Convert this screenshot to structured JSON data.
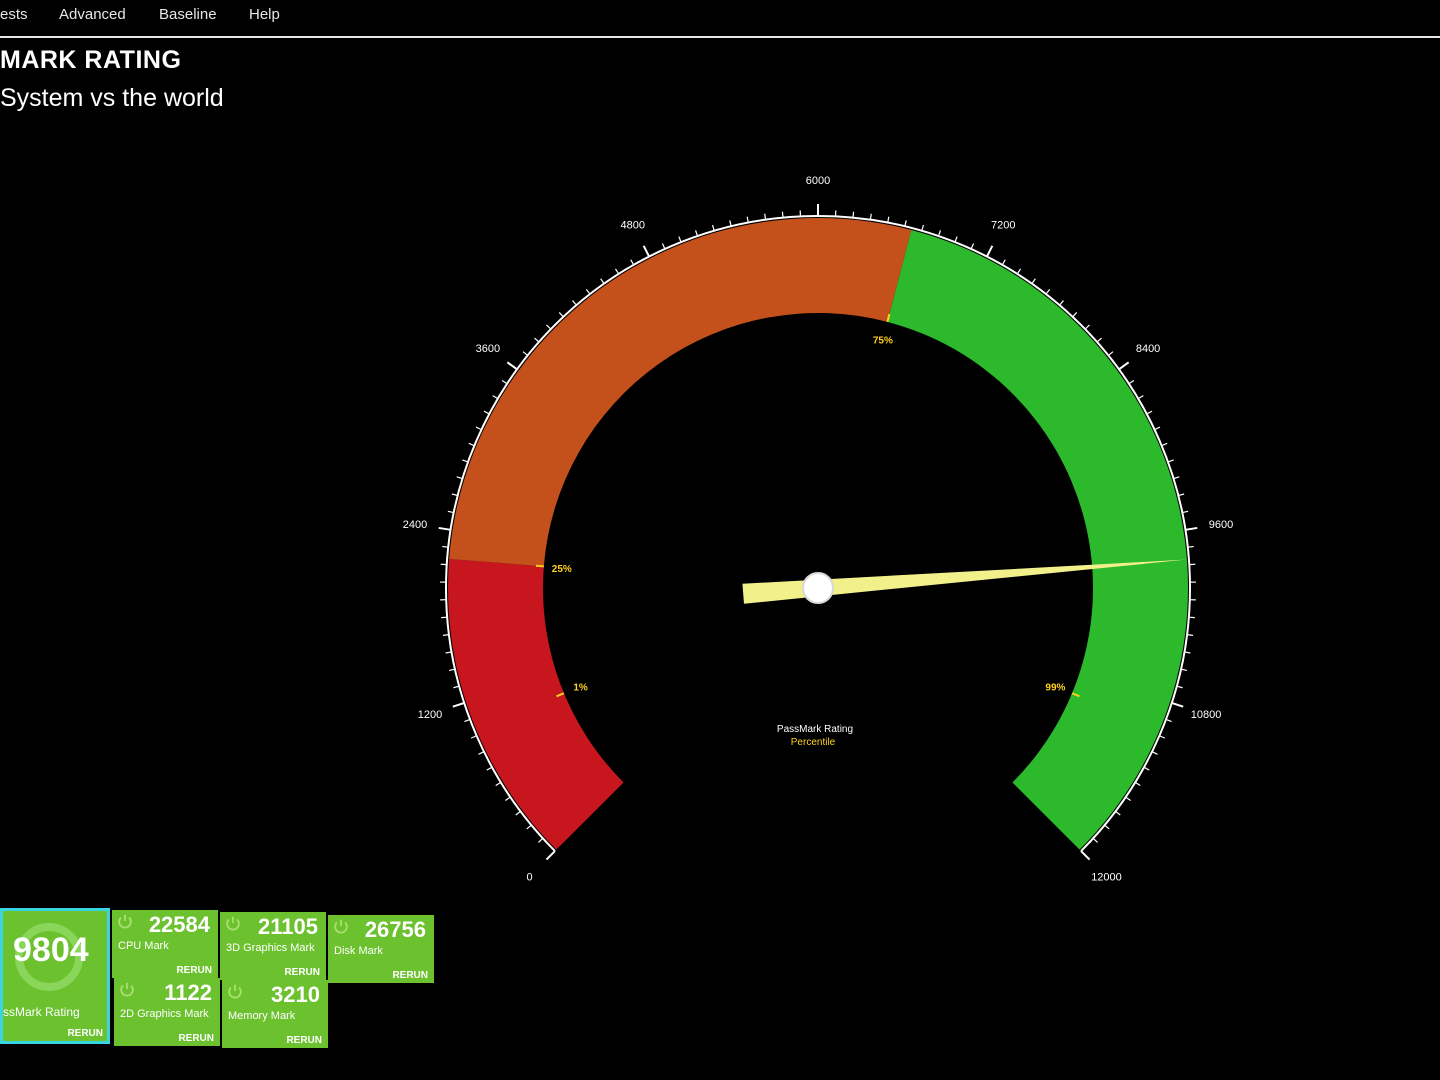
{
  "menu": {
    "items": [
      "ests",
      "Advanced",
      "Baseline",
      "Help"
    ]
  },
  "header": {
    "title": "MARK RATING",
    "subtitle": "System vs the world"
  },
  "gauge": {
    "min": 0,
    "max": 12000,
    "value": 9804,
    "tick_labels": [
      "0",
      "1200",
      "2400",
      "3600",
      "4800",
      "6000",
      "7200",
      "8400",
      "9600",
      "10800",
      "12000"
    ],
    "percentile_markers": [
      {
        "label": "1%",
        "value": 1000
      },
      {
        "label": "25%",
        "value": 2200
      },
      {
        "label": "75%",
        "value": 6650
      },
      {
        "label": "99%",
        "value": 11000
      }
    ],
    "bands": [
      {
        "from": 0,
        "to": 2200,
        "color": "#c8161e"
      },
      {
        "from": 2200,
        "to": 6650,
        "color": "#c4501c"
      },
      {
        "from": 6650,
        "to": 12000,
        "color": "#2cb92c"
      }
    ],
    "center_label": "PassMark Rating",
    "center_sublabel": "Percentile",
    "needle_color": "#f2f08a",
    "accent_color": "#ffd21e"
  },
  "tiles": {
    "main": {
      "value": "9804",
      "label": "ssMark Rating",
      "rerun": "RERUN"
    },
    "items": [
      {
        "value": "22584",
        "label": "CPU Mark",
        "rerun": "RERUN"
      },
      {
        "value": "21105",
        "label": "3D Graphics Mark",
        "rerun": "RERUN"
      },
      {
        "value": "26756",
        "label": "Disk Mark",
        "rerun": "RERUN"
      },
      {
        "value": "1122",
        "label": "2D Graphics Mark",
        "rerun": "RERUN"
      },
      {
        "value": "3210",
        "label": "Memory Mark",
        "rerun": "RERUN"
      }
    ]
  },
  "colors": {
    "tile_green": "#6cc12e",
    "tile_border_active": "#39d6e0"
  }
}
